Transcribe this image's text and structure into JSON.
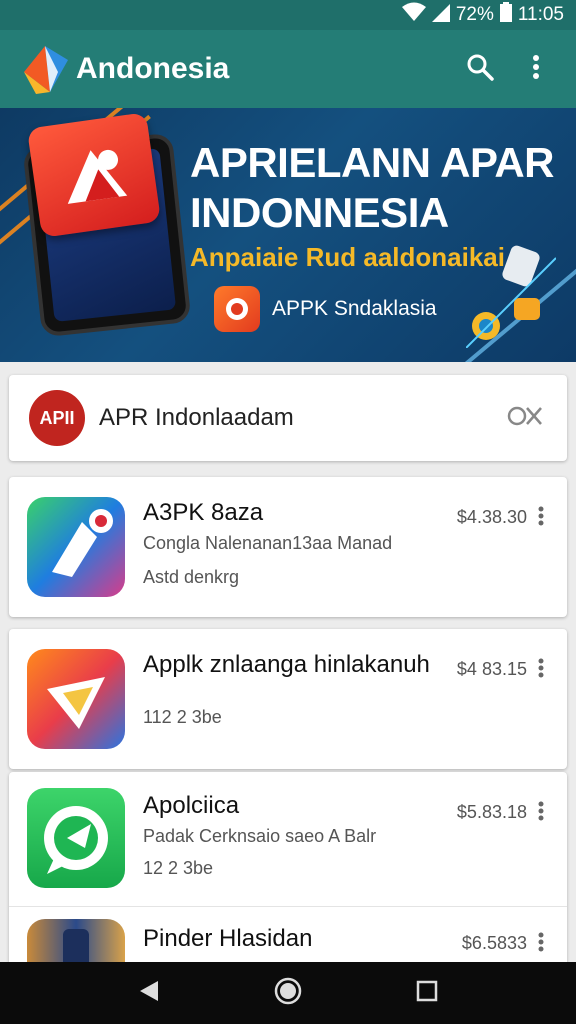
{
  "status": {
    "battery": "72%",
    "time": "11:05"
  },
  "app_bar": {
    "title": "Andonesia",
    "icons": [
      "search-icon",
      "more-vert-icon"
    ]
  },
  "banner": {
    "headline_line1": "APRIELANN APAR",
    "headline_line2": "INDONNESIA",
    "tagline": "Anpaiaie Rud aaldonaikai",
    "mini_app_label": "APPK Sndaklasia"
  },
  "search": {
    "logo_text": "APII",
    "query": "APR Indonlaadam"
  },
  "apps": [
    {
      "name": "A3PK 8aza",
      "subtitle": "Congla Nalenanan13aa Manad",
      "meta": "Astd denkrg",
      "price": "$4.38.30"
    },
    {
      "name": "Applk znlaanga hinlakanuh",
      "subtitle": "",
      "meta": "112 2 3be",
      "price": "$4 83.15"
    },
    {
      "name": "Apolciica",
      "subtitle": "Padak Cerknsaio saeo A Balr",
      "meta": "12 2 3be",
      "price": "$5.83.18"
    },
    {
      "name": "Pinder Hlasidan",
      "subtitle": "",
      "meta": "",
      "price": "$6.5833"
    }
  ],
  "colors": {
    "app_bar": "#247d76",
    "status_bar": "#1f6f6a",
    "banner_accent": "#f5b928"
  }
}
